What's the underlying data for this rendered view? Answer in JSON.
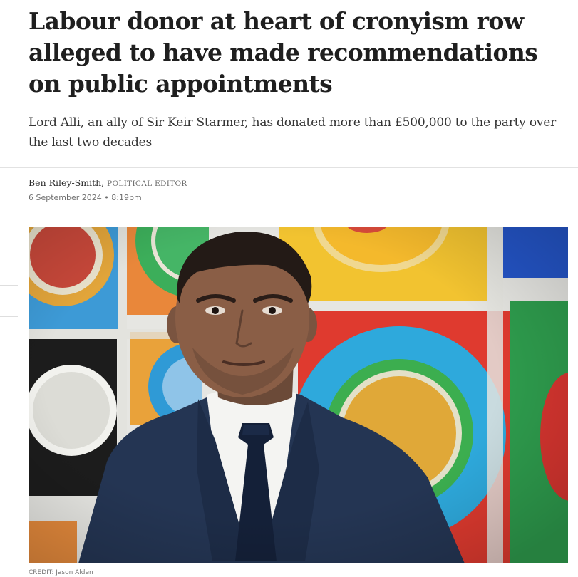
{
  "article": {
    "headline": "Labour donor at heart of cronyism row alleged to have made recommendations on public appointments",
    "standfirst": "Lord Alli, an ally of Sir Keir Starmer, has donated more than £500,000 to the party over the last two decades",
    "author_name": "Ben Riley-Smith,",
    "author_role": "POLITICAL EDITOR",
    "published": "6 September 2024 • 8:19pm"
  },
  "image": {
    "credit": "CREDIT: Jason Alden",
    "icon": "portrait-photo"
  },
  "colors": {
    "headline": "#1f1f1f",
    "body_text": "#333333",
    "meta_text": "#707070",
    "divider": "#e2e2e2"
  }
}
